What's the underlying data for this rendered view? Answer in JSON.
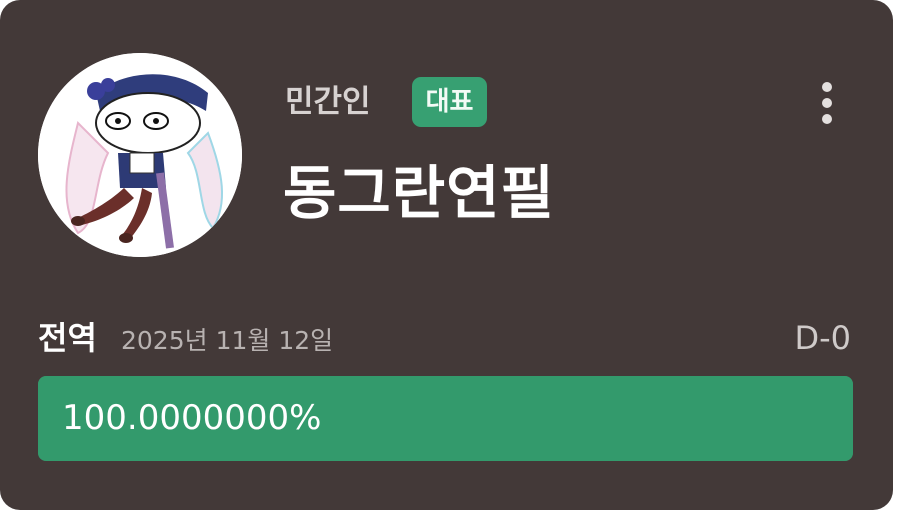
{
  "profile": {
    "rank": "민간인",
    "badge": "대표",
    "name": "동그란연필",
    "avatar_icon": "chibi-character-avatar"
  },
  "menu": {
    "icon": "kebab-menu-icon"
  },
  "service": {
    "phase_label": "전역",
    "date": "2025년 11월 12일",
    "dday": "D-0",
    "progress_text": "100.0000000%",
    "progress_fraction": 1.0
  },
  "colors": {
    "card_bg": "#433938",
    "accent_green": "#339a6c",
    "badge_green": "#37a072"
  }
}
